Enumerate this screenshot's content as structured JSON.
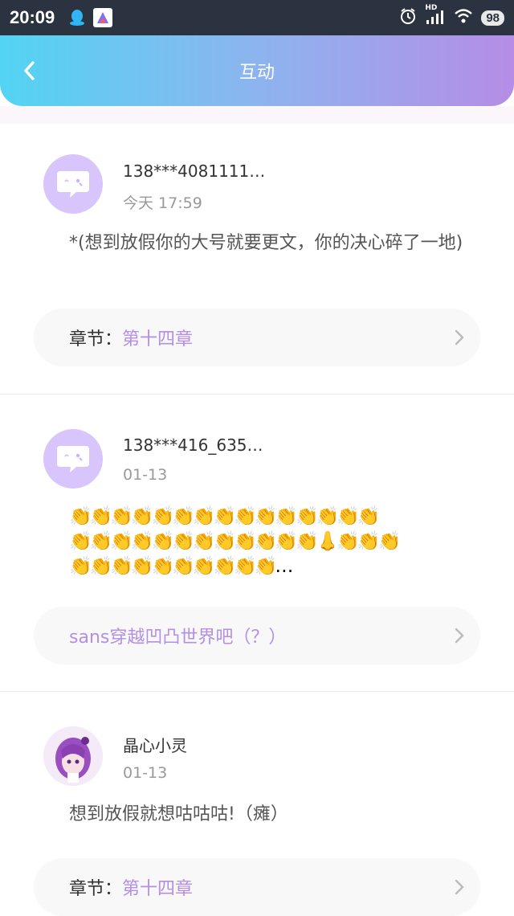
{
  "status_bar": {
    "time": "20:09",
    "battery": "98",
    "hd_label": "HD"
  },
  "header": {
    "title": "互动"
  },
  "posts": [
    {
      "username": "138***4081111…",
      "time": "今天 17:59",
      "content": "*(想到放假你的大号就要更文，你的决心碎了一地)",
      "chapter_label": "章节：",
      "chapter_value": "第十四章"
    },
    {
      "username": "138***416_635…",
      "time": "01-13",
      "content_line1": "👏👏👏👏👏👏👏👏👏👏👏👏👏👏👏",
      "content_line2": "👏👏👏👏👏👏👏👏👏👏👏👏👃👏👏👏",
      "content_line3": "👏👏👏👏👏👏👏👏👏👏…",
      "chapter_value": "sans穿越凹凸世界吧（？）"
    },
    {
      "username": "晶心小灵",
      "time": "01-13",
      "content": "想到放假就想咕咕咕!（瘫）",
      "chapter_label": "章节：",
      "chapter_value": "第十四章"
    }
  ]
}
